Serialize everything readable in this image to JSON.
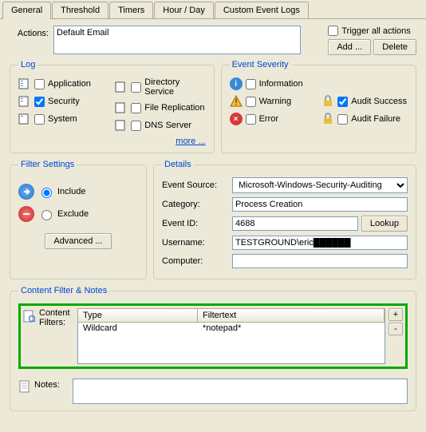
{
  "tabs": {
    "t0": "General",
    "t1": "Threshold",
    "t2": "Timers",
    "t3": "Hour / Day",
    "t4": "Custom Event Logs"
  },
  "actions": {
    "label": "Actions:",
    "value": "Default Email",
    "trigger": "Trigger all actions",
    "add": "Add ...",
    "delete": "Delete"
  },
  "log": {
    "legend": "Log",
    "application": "Application",
    "security": "Security",
    "system": "System",
    "directory": "Directory Service",
    "filerep": "File Replication",
    "dns": "DNS Server",
    "more": "more ..."
  },
  "severity": {
    "legend": "Event Severity",
    "information": "Information",
    "warning": "Warning",
    "error": "Error",
    "auditsuccess": "Audit Success",
    "auditfailure": "Audit Failure"
  },
  "filterset": {
    "legend": "Filter Settings",
    "include": "Include",
    "exclude": "Exclude",
    "advanced": "Advanced ..."
  },
  "details": {
    "legend": "Details",
    "source_l": "Event Source:",
    "source_v": "Microsoft-Windows-Security-Auditing",
    "cat_l": "Category:",
    "cat_v": "Process Creation",
    "id_l": "Event ID:",
    "id_v": "4688",
    "lookup": "Lookup",
    "user_l": "Username:",
    "user_v": "TESTGROUND\\eric██████",
    "comp_l": "Computer:",
    "comp_v": ""
  },
  "content": {
    "legend": "Content Filter & Notes",
    "filters_l": "Content Filters:",
    "col_type": "Type",
    "col_text": "Filtertext",
    "row_type": "Wildcard",
    "row_text": "*notepad*",
    "plus": "+",
    "minus": "-",
    "notes_l": "Notes:",
    "notes_v": ""
  }
}
